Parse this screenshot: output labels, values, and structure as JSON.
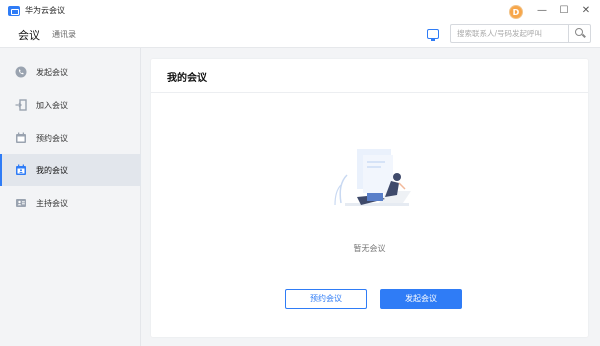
{
  "window": {
    "app_title": "华为云会议",
    "avatar_letter": "D",
    "controls": {
      "minimize": "—",
      "maximize": "☐",
      "close": "✕"
    }
  },
  "header": {
    "tab_meeting": "会议",
    "tab_contacts": "通讯录",
    "search": {
      "placeholder": "搜索联系人/号码发起呼叫",
      "value": ""
    }
  },
  "sidebar": {
    "items": [
      {
        "label": "发起会议",
        "icon": "phone-icon",
        "active": false
      },
      {
        "label": "加入会议",
        "icon": "enter-door-icon",
        "active": false
      },
      {
        "label": "预约会议",
        "icon": "calendar-icon",
        "active": false
      },
      {
        "label": "我的会议",
        "icon": "calendar-person-icon",
        "active": true
      },
      {
        "label": "主持会议",
        "icon": "host-id-icon",
        "active": false
      }
    ]
  },
  "main": {
    "title": "我的会议",
    "empty_text": "暂无会议",
    "schedule_button": "预约会议",
    "start_button": "发起会议"
  },
  "colors": {
    "accent": "#2f7cf6",
    "sidebar_bg": "#f3f4f6",
    "active_bg": "#e2e6ec",
    "avatar": "#f7a64a"
  }
}
